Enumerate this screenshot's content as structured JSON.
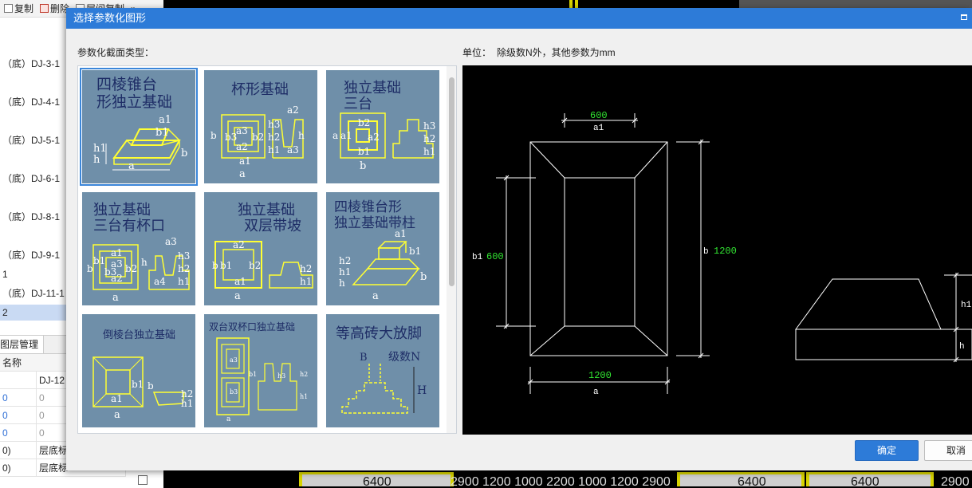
{
  "toolbar": {
    "copy_label": "复制",
    "delete_label": "删除",
    "floor_copy_label": "层间复制",
    "more_glyph": "»"
  },
  "element_list": [
    {
      "label": "（底）DJ-3-1",
      "selected": false
    },
    {
      "label": "（底）DJ-4-1",
      "selected": false
    },
    {
      "label": "（底）DJ-5-1",
      "selected": false
    },
    {
      "label": "（底）DJ-6-1",
      "selected": false
    },
    {
      "label": "（底）DJ-8-1",
      "selected": false
    },
    {
      "label": "（底）DJ-9-1",
      "selected": false
    },
    {
      "label": "1",
      "selected": false
    },
    {
      "label": "（底）DJ-11-1",
      "selected": false
    },
    {
      "label": "2",
      "selected": true
    }
  ],
  "layer_panel": {
    "tab_label": "图层管理",
    "name_header": "名称",
    "rows": [
      {
        "left": "",
        "right": "DJ-12"
      },
      {
        "left": "0",
        "right": "0"
      },
      {
        "left": "0",
        "right": "0"
      },
      {
        "left": "0",
        "right": "0"
      },
      {
        "left": "0)",
        "right": "层底标"
      },
      {
        "left": "0)",
        "right": "层底标"
      }
    ]
  },
  "bottom_dims": {
    "d1": "6400",
    "mid": "2900 1200 1000 2200 1000 1200 2900",
    "d2": "6400",
    "d3": "6400",
    "end": "2900"
  },
  "dialog": {
    "title": "选择参数化图形",
    "section_label": "参数化截面类型：",
    "unit_label": "单位：",
    "unit_value": "除级数N外，其他参数为mm",
    "ok_label": "确定",
    "cancel_label": "取消"
  },
  "thumbnails": [
    {
      "title_1": "四棱锥台",
      "title_2": "形独立基础",
      "selected": true
    },
    {
      "title_1": "杯形基础",
      "title_2": "",
      "selected": false
    },
    {
      "title_1": "独立基础",
      "title_2": "三台",
      "selected": false
    },
    {
      "title_1": "独立基础",
      "title_2": "三台有杯口",
      "selected": false
    },
    {
      "title_1": "独立基础",
      "title_2": "双层带坡",
      "selected": false
    },
    {
      "title_1": "四棱锥台形",
      "title_2": "独立基础带柱",
      "selected": false
    },
    {
      "title_1": "倒棱台独立基础",
      "title_2": "",
      "selected": false
    },
    {
      "title_1": "双台双杯口独立基础",
      "title_2": "",
      "selected": false
    },
    {
      "title_1": "等高砖大放脚",
      "title_2": "",
      "selected": false
    }
  ],
  "thumb_labels": {
    "a": "a",
    "b": "b",
    "a1": "a1",
    "a2": "a2",
    "a3": "a3",
    "a4": "a4",
    "b1": "b1",
    "b2": "b2",
    "b3": "b3",
    "h": "h",
    "h1": "h1",
    "h2": "h2",
    "h3": "h3",
    "B": "B",
    "H": "H",
    "levels": "级数N"
  },
  "preview": {
    "a1_value": "600",
    "a1_label": "a1",
    "b1_label": "b1",
    "b1_value": "600",
    "b_label": "b",
    "b_value": "1200",
    "a_value": "1200",
    "a_label": "a",
    "h1_label": "h1",
    "h_label": "h"
  },
  "colors": {
    "accent": "#2d7bd8",
    "thumb_bg": "#6f8fa9",
    "cad_green": "#32e632",
    "cad_line": "#ffffff",
    "cad_yellow": "#e8e800"
  }
}
